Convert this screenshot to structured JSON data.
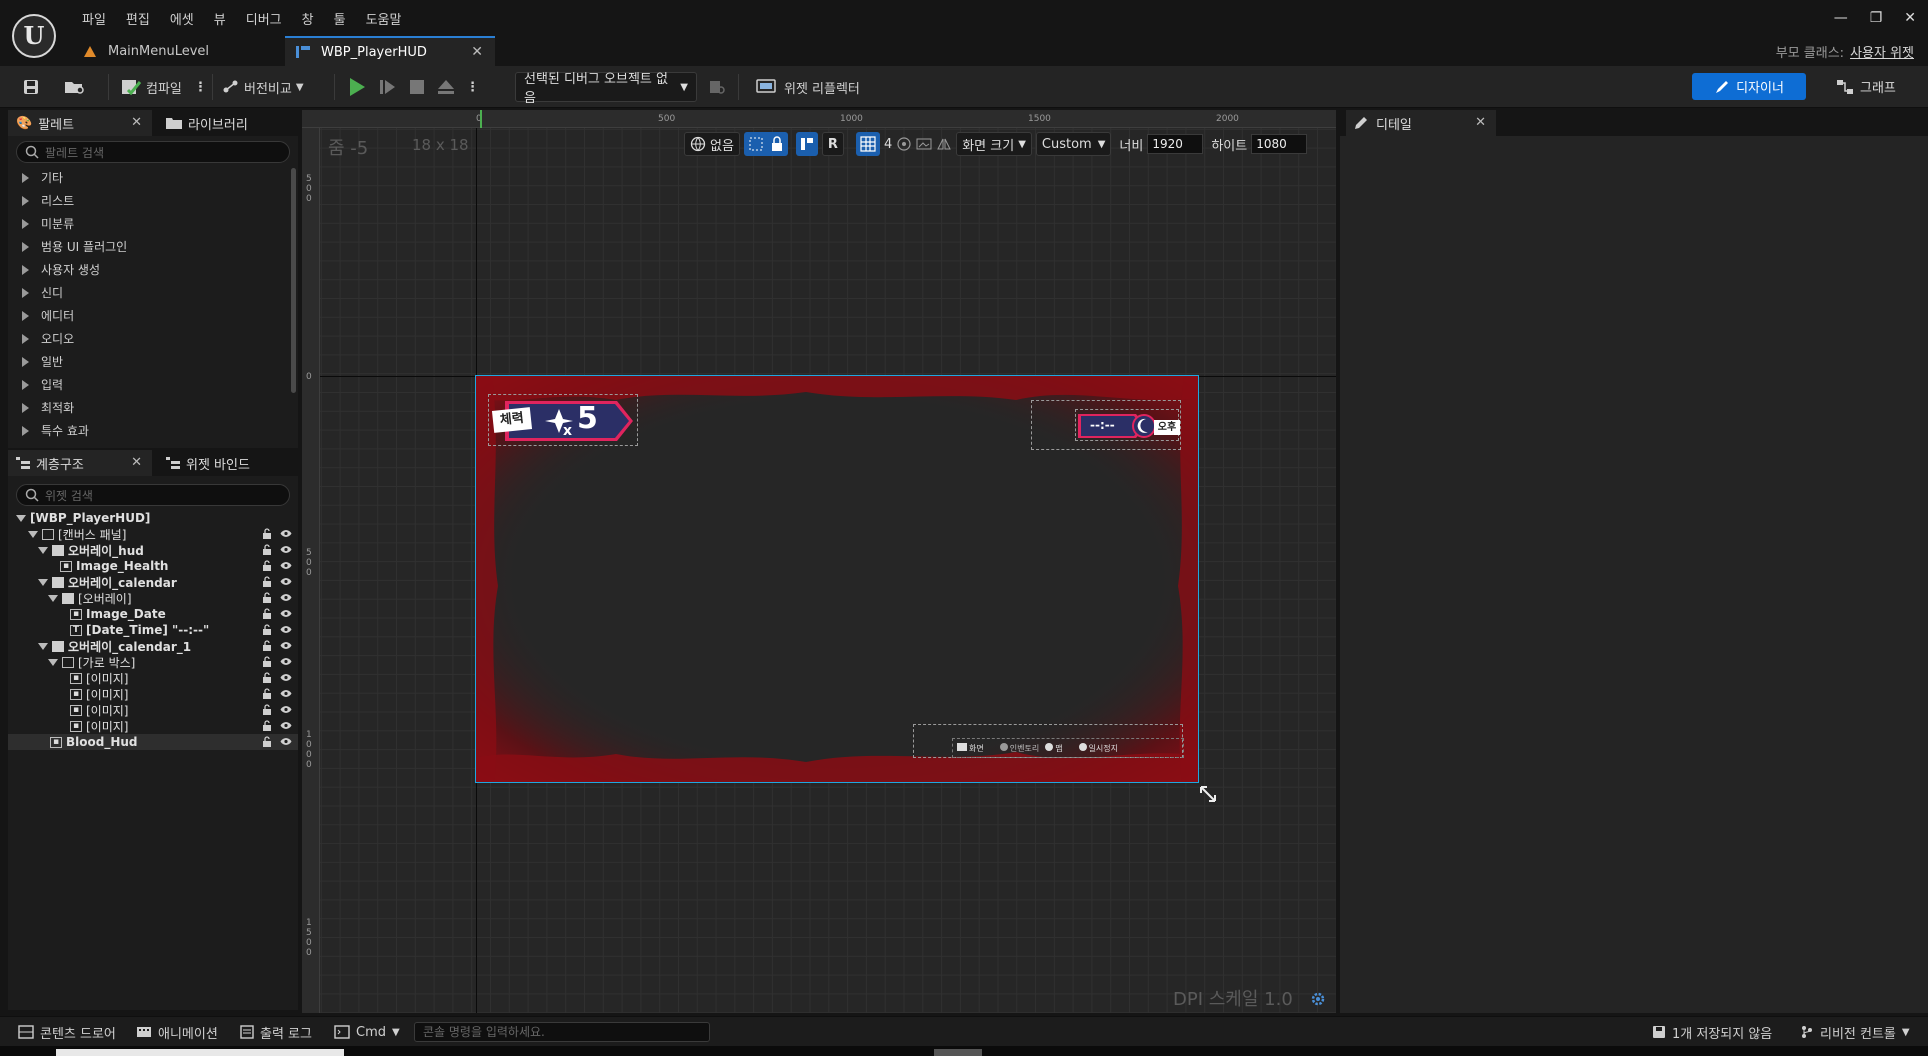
{
  "app": {
    "menu": [
      "파일",
      "편집",
      "에셋",
      "뷰",
      "디버그",
      "창",
      "툴",
      "도움말"
    ],
    "tabs": [
      {
        "label": "MainMenuLevel"
      },
      {
        "label": "WBP_PlayerHUD"
      }
    ],
    "parent_class_label": "부모 클래스:",
    "parent_class_value": "사용자 위젯"
  },
  "toolbar": {
    "compile": "컴파일",
    "version_control": "버전비교",
    "debug_object": "선택된 디버그 오브젝트 없음",
    "widget_reflector": "위젯 리플렉터",
    "designer": "디자이너",
    "graph": "그래프"
  },
  "palette": {
    "tab": "팔레트",
    "library_tab": "라이브러리",
    "search_placeholder": "팔레트 검색",
    "categories": [
      "기타",
      "리스트",
      "미분류",
      "범용 UI 플러그인",
      "사용자 생성",
      "신디",
      "에디터",
      "오디오",
      "일반",
      "입력",
      "최적화",
      "특수 효과"
    ]
  },
  "hierarchy": {
    "tab": "계층구조",
    "bind_tab": "위젯 바인드",
    "search_placeholder": "위젯 검색",
    "items": [
      {
        "label": "[WBP_PlayerHUD]"
      },
      {
        "label": "[캔버스 패널]"
      },
      {
        "label": "오버레이_hud"
      },
      {
        "label": "Image_Health"
      },
      {
        "label": "오버레이_calendar"
      },
      {
        "label": "[오버레이]"
      },
      {
        "label": "Image_Date"
      },
      {
        "label": "[Date_Time] \"--:--\""
      },
      {
        "label": "오버레이_calendar_1"
      },
      {
        "label": "[가로 박스]"
      },
      {
        "label": "[이미지]"
      },
      {
        "label": "[이미지]"
      },
      {
        "label": "[이미지]"
      },
      {
        "label": "[이미지]"
      },
      {
        "label": "Blood_Hud"
      }
    ]
  },
  "viewport": {
    "zoom": "줌 -5",
    "grid": "18 x 18",
    "ruler_h": [
      "0",
      "500",
      "1000",
      "1500",
      "2000"
    ],
    "ruler_v": [
      "500",
      "0",
      "500",
      "1000",
      "1500"
    ],
    "localization": "없음",
    "grid_snap": "4",
    "screen_size": "화면 크기",
    "size_preset": "Custom",
    "width_label": "너비",
    "width_value": "1920",
    "height_label": "하이트",
    "height_value": "1080",
    "dpi": "DPI 스케일 1.0"
  },
  "hud": {
    "health_label": "체력",
    "health_x": "x",
    "health_count": "5",
    "time_text": "--:--",
    "ampm": "오후",
    "bottom_items": [
      "화면",
      "인벤토리",
      "맵",
      "일시정지"
    ]
  },
  "details": {
    "tab": "디테일"
  },
  "statusbar": {
    "content_drawer": "콘텐츠 드로어",
    "animation": "애니메이션",
    "output_log": "출력 로그",
    "cmd": "Cmd",
    "cmd_placeholder": "콘솔 명령을 입력하세요.",
    "unsaved": "1개 저장되지 않음",
    "revision": "리비전 컨트롤"
  },
  "colors": {
    "accent": "#0e6dd4",
    "selection": "#1fa7e0",
    "blood": "#8a0d14",
    "health_badge": "#e0245e",
    "play_green": "#4caf50"
  }
}
